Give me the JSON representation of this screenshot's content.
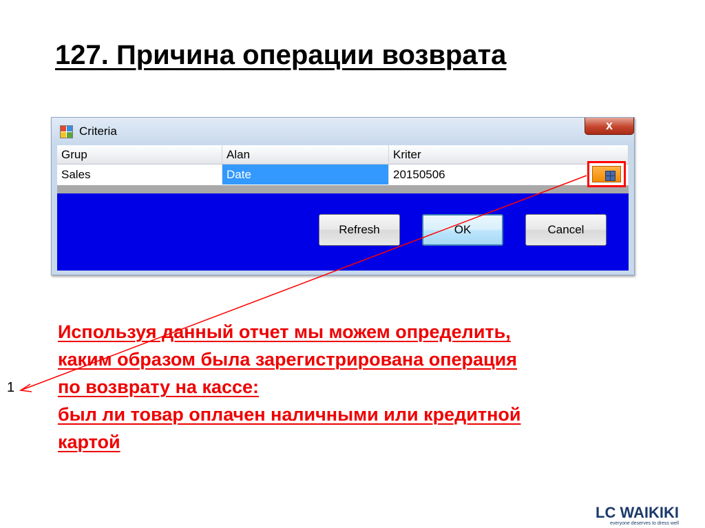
{
  "slide": {
    "title": "127. Причина операции возврата"
  },
  "dialog": {
    "title": "Criteria",
    "close_label": "x",
    "columns": [
      "Grup",
      "Alan",
      "Kriter"
    ],
    "row": {
      "grup": "Sales",
      "alan": "Date",
      "kriter": "20150506"
    },
    "buttons": {
      "refresh": "Refresh",
      "ok": "OK",
      "cancel": "Cancel"
    }
  },
  "annotation": {
    "number": "1",
    "lines": [
      "Используя данный отчет мы можем определить,",
      "каким образом была зарегистрирована операция",
      "по возврату на кассе:",
      "был ли товар оплачен наличными или кредитной",
      "картой"
    ],
    "color": "#ee0000"
  },
  "brand": {
    "logo": "LC WAIKIKI",
    "slogan": "everyone deserves to dress well"
  },
  "colors": {
    "dialog_client": "#0000e6",
    "selection": "#3399ff",
    "lookup_button": "#f28c00",
    "highlight": "#ff0000"
  }
}
